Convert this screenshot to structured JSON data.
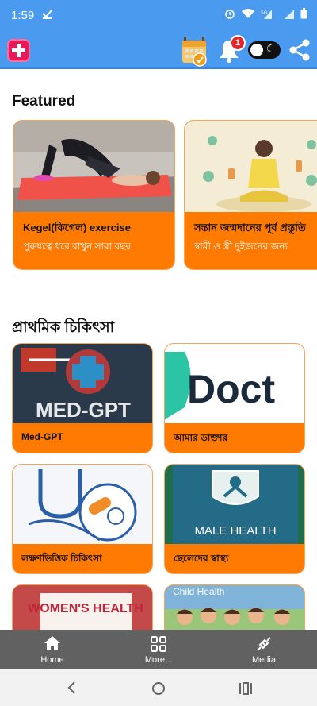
{
  "status_bar": {
    "time": "1:59"
  },
  "app_bar": {
    "notification_count": "1"
  },
  "featured": {
    "title": "Featured",
    "cards": [
      {
        "title": "Kegel(কিগেল) exercise",
        "subtitle": "পুরুষত্বে ধরে রাখুন সারা বছর"
      },
      {
        "title": "সন্তান জন্মদানের পূর্ব প্রস্তুতি",
        "subtitle": "স্বামী ও স্ত্রী দুইজনের জন্য"
      }
    ]
  },
  "first_aid": {
    "title": "প্রাথমিক চিকিৎসা",
    "cards": [
      {
        "label": "Med-GPT",
        "image_text": "MED-GPT"
      },
      {
        "label": "আমার ডাক্তার",
        "image_text": "Doct"
      },
      {
        "label": "লক্ষণভিত্তিক চিকিৎসা"
      },
      {
        "label": "ছেলেদের স্বাস্থ্য",
        "image_text": "MALE HEALTH"
      },
      {
        "label": "",
        "image_text": "WOMEN'S HEALTH"
      },
      {
        "label": "",
        "image_text": "Child Health"
      }
    ]
  },
  "bottom_nav": {
    "items": [
      {
        "label": "Home",
        "icon": "home-icon"
      },
      {
        "label": "More...",
        "icon": "grid-icon"
      },
      {
        "label": "Media",
        "icon": "media-icon"
      }
    ]
  },
  "colors": {
    "primary": "#4a9bf0",
    "card": "#ff7a00",
    "nav": "#616161",
    "badge": "#e3262b"
  }
}
